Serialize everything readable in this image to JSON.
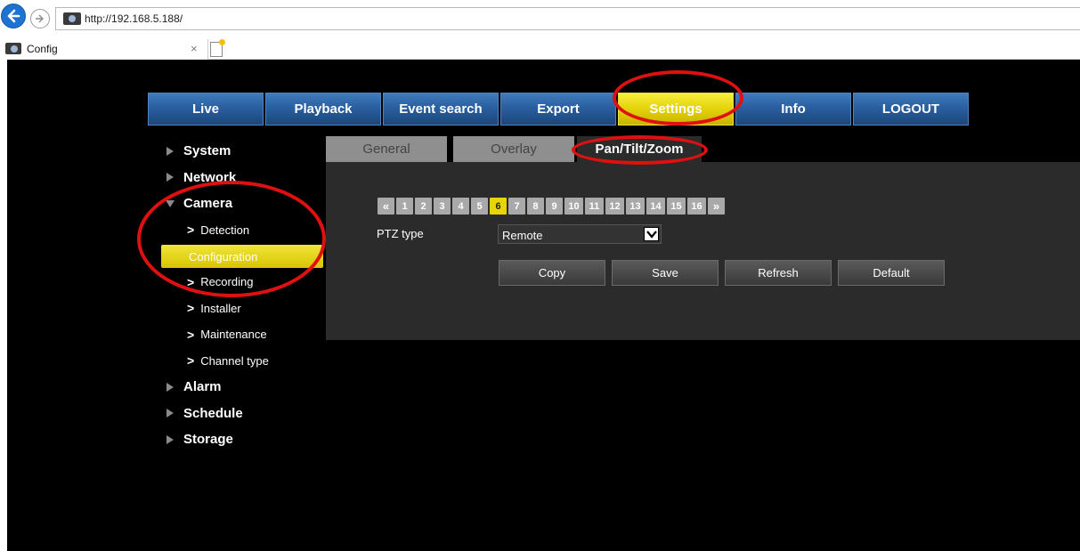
{
  "browser": {
    "url": "http://192.168.5.188/",
    "tab_title": "Config",
    "tab_close": "×"
  },
  "nav": {
    "items": [
      "Live",
      "Playback",
      "Event search",
      "Export",
      "Settings",
      "Info",
      "LOGOUT"
    ],
    "active_index": 4
  },
  "sidebar": {
    "system": "System",
    "network": "Network",
    "camera": "Camera",
    "camera_items": {
      "detection": "Detection",
      "configuration": "Configuration",
      "recording": "Recording",
      "installer": "Installer",
      "maintenance": "Maintenance",
      "channel_type": "Channel type"
    },
    "alarm": "Alarm",
    "schedule": "Schedule",
    "storage": "Storage",
    "chevron": ">"
  },
  "subtabs": {
    "general": "General",
    "overlay": "Overlay",
    "ptz": "Pan/Tilt/Zoom"
  },
  "pager": {
    "prev": "«",
    "next": "»",
    "pages": [
      "1",
      "2",
      "3",
      "4",
      "5",
      "6",
      "7",
      "8",
      "9",
      "10",
      "11",
      "12",
      "13",
      "14",
      "15",
      "16"
    ],
    "selected": "6"
  },
  "ptz": {
    "label": "PTZ type",
    "value": "Remote",
    "dropdown_glyph": "✓"
  },
  "actions": {
    "copy": "Copy",
    "save": "Save",
    "refresh": "Refresh",
    "default": "Default"
  },
  "colors": {
    "accent": "#e8d400",
    "nav_blue": "#2a5f9f",
    "annotation": "#e01010"
  }
}
